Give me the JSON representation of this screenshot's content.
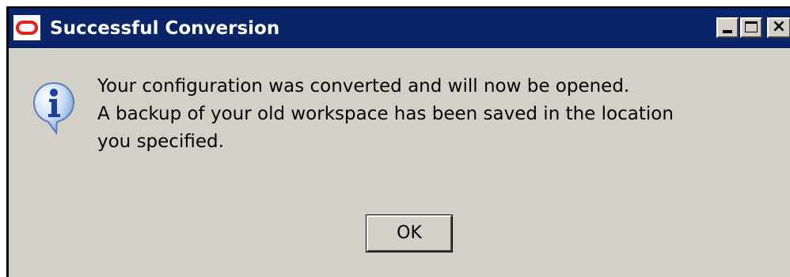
{
  "dialog": {
    "title": "Successful Conversion",
    "title_bar_color": "#0a246a",
    "app_icon": "oracle-logo-icon",
    "message_icon": "information-icon",
    "message_lines": [
      "Your configuration was converted and will now be opened.",
      "A backup of your old workspace has been saved in the location",
      "you specified."
    ],
    "ok_label": "OK"
  },
  "window_controls": [
    "minimize-icon",
    "maximize-icon",
    "close-icon"
  ],
  "colors": {
    "title_bar": "#0a246a",
    "dialog_background": "#d4d0c8",
    "brand_red": "#e32119"
  }
}
